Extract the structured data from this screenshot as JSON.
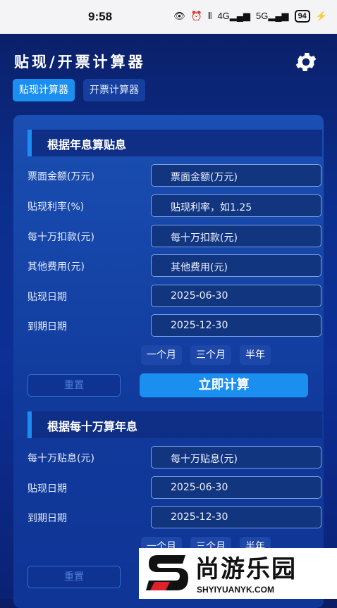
{
  "status": {
    "time": "9:58",
    "net1": "4G",
    "net2": "5G",
    "battery": "94"
  },
  "header": {
    "title": "贴现/开票计算器"
  },
  "tabs": [
    {
      "label": "贴现计算器"
    },
    {
      "label": "开票计算器"
    }
  ],
  "section1": {
    "title": "根据年息算贴息",
    "rows": [
      {
        "label": "票面金额(万元)",
        "value": "票面金额(万元)"
      },
      {
        "label": "贴现利率(%)",
        "value": "贴现利率，如1.25"
      },
      {
        "label": "每十万扣款(元)",
        "value": "每十万扣款(元)"
      },
      {
        "label": "其他费用(元)",
        "value": "其他费用(元)"
      },
      {
        "label": "贴现日期",
        "value": "2025-06-30"
      },
      {
        "label": "到期日期",
        "value": "2025-12-30"
      }
    ],
    "quick": [
      "一个月",
      "三个月",
      "半年"
    ],
    "reset_label": "重置",
    "calc_label": "立即计算"
  },
  "section2": {
    "title": "根据每十万算年息",
    "rows": [
      {
        "label": "每十万贴息(元)",
        "value": "每十万贴息(元)"
      },
      {
        "label": "贴现日期",
        "value": "2025-06-30"
      },
      {
        "label": "到期日期",
        "value": "2025-12-30"
      }
    ],
    "quick": [
      "一个月",
      "三个月",
      "半年"
    ],
    "reset_label": "重置"
  },
  "watermark": {
    "name": "尚游乐园",
    "url": "SHYIYUANYK.COM"
  },
  "colors": {
    "accent": "#1b8ff0",
    "card": "#1b4fb3",
    "background": "#0b2f8e"
  }
}
